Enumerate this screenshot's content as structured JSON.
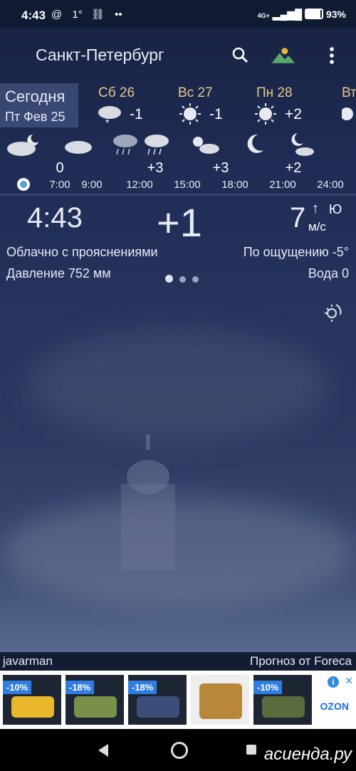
{
  "status_bar": {
    "time": "4:43",
    "temp": "1°",
    "battery": "93%",
    "network": "4G+"
  },
  "app_bar": {
    "city": "Санкт-Петербург"
  },
  "today": {
    "label": "Сегодня",
    "date": "Пт Фев 25"
  },
  "days": [
    {
      "name": "Сб 26",
      "temp": "-1",
      "icon": "snow-cloud-icon"
    },
    {
      "name": "Вс 27",
      "temp": "-1",
      "icon": "sun-icon"
    },
    {
      "name": "Пн 28",
      "temp": "+2",
      "icon": "sun-icon"
    },
    {
      "name": "Вт",
      "temp": "",
      "icon": "sun-icon"
    }
  ],
  "hourly": {
    "temps": [
      {
        "value": "0"
      },
      {
        "value": "+3"
      },
      {
        "value": "+3"
      },
      {
        "value": "+2"
      }
    ],
    "times": [
      "7:00",
      "9:00",
      "12:00",
      "15:00",
      "18:00",
      "21:00",
      "24:00"
    ]
  },
  "current": {
    "time": "4:43",
    "temp": "+1",
    "wind_speed": "7",
    "wind_arrow": "↑",
    "wind_dir": "Ю",
    "wind_unit": "м/с",
    "condition": "Облачно с прояснениями",
    "feels_like": "По ощущению -5°",
    "pressure": "Давление 752 мм",
    "water": "Вода 0"
  },
  "footer": {
    "author": "javarman",
    "source": "Прогноз от Foreca"
  },
  "ad": {
    "items": [
      {
        "discount": "-10%",
        "color": "#e8b72b"
      },
      {
        "discount": "-18%",
        "color": "#7a8f4a"
      },
      {
        "discount": "-18%",
        "color": "#3c4d7a"
      },
      {
        "discount": "",
        "color": "#b8873a"
      },
      {
        "discount": "-10%",
        "color": "#5b6b3e"
      }
    ],
    "brand": "OZON",
    "info": "i",
    "close": "✕"
  },
  "watermark": "асиенда.ру"
}
